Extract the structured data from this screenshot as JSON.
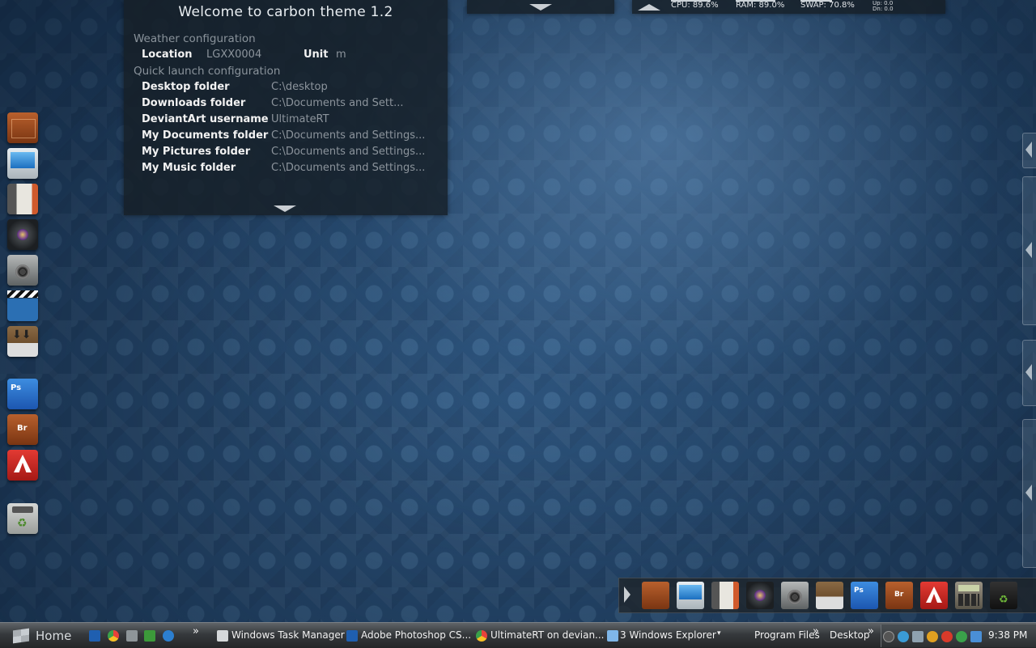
{
  "welcome": {
    "title": "Welcome to carbon theme 1.2",
    "weather_section": "Weather configuration",
    "location_label": "Location",
    "location_value": "LGXX0004",
    "unit_label": "Unit",
    "unit_value": "m",
    "quicklaunch_section": "Quick launch configuration",
    "rows": [
      {
        "label": "Desktop folder",
        "value": "C:\\desktop"
      },
      {
        "label": "Downloads folder",
        "value": "C:\\Documents and Sett..."
      },
      {
        "label": "DeviantArt username",
        "value": "UltimateRT"
      },
      {
        "label": "My Documents folder",
        "value": "C:\\Documents and Settings..."
      },
      {
        "label": "My Pictures folder",
        "value": "C:\\Documents and Settings..."
      },
      {
        "label": "My Music folder",
        "value": "C:\\Documents and Settings..."
      }
    ]
  },
  "stats": {
    "cpu": "CPU: 89.6%",
    "ram": "RAM: 89.0%",
    "swap": "SWAP: 70.8%",
    "up": "Up: 0.0",
    "dn": "Dn: 0.0",
    "cpu_level": 0.896,
    "ram_level": 0.89,
    "swap_level": 0.708
  },
  "left_dock": [
    {
      "icon": "wooden-cabinet-icon"
    },
    {
      "icon": "monitor-icon"
    },
    {
      "icon": "notebook-icon"
    },
    {
      "icon": "camera-lens-icon"
    },
    {
      "icon": "speaker-icon"
    },
    {
      "icon": "clapperboard-icon"
    },
    {
      "icon": "downloads-box-icon"
    },
    {
      "icon": "photoshop-icon",
      "text": "Ps"
    },
    {
      "icon": "bridge-icon",
      "text": "Br"
    },
    {
      "icon": "acrobat-icon"
    },
    {
      "icon": "recycle-bin-icon"
    }
  ],
  "bottom_dock": [
    {
      "icon": "wooden-cabinet-icon"
    },
    {
      "icon": "monitor-icon"
    },
    {
      "icon": "notebook-icon"
    },
    {
      "icon": "camera-lens-icon"
    },
    {
      "icon": "speaker-icon"
    },
    {
      "icon": "downloads-box-icon"
    },
    {
      "icon": "photoshop-icon",
      "text": "Ps"
    },
    {
      "icon": "bridge-icon",
      "text": "Br"
    },
    {
      "icon": "acrobat-icon"
    },
    {
      "icon": "calculator-icon"
    },
    {
      "icon": "recycle-bin-icon"
    }
  ],
  "taskbar": {
    "start_label": "Home",
    "chevron": "»",
    "windows": [
      {
        "label": "Windows Task Manager",
        "icon": "task-manager-icon"
      },
      {
        "label": "Adobe Photoshop CS...",
        "icon": "photoshop-icon"
      },
      {
        "label": "UltimateRT on devian...",
        "icon": "chrome-icon"
      },
      {
        "label": "3 Windows Explorer",
        "icon": "explorer-icon"
      }
    ],
    "group_dropdown": "▾",
    "toolbars": [
      "Program Files",
      "Desktop"
    ],
    "clock": "9:38 PM"
  },
  "colors": {
    "background": "#2a4f76",
    "panel": "#161e26",
    "taskbar": "#36393c"
  }
}
